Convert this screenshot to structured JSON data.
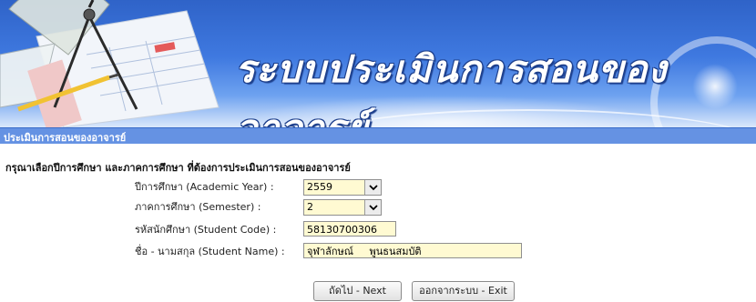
{
  "banner": {
    "title": "ระบบประเมินการสอนของอาจารย์"
  },
  "section": {
    "title": "ประเมินการสอนของอาจารย์"
  },
  "form": {
    "instruction": "กรุณาเลือกปีการศึกษา และภาคการศึกษา ที่ต้องการประเมินการสอนของอาจารย์",
    "academic_year": {
      "label": "ปีการศึกษา (Academic Year) :",
      "value": "2559"
    },
    "semester": {
      "label": "ภาคการศึกษา (Semester) :",
      "value": "2"
    },
    "student_code": {
      "label": "รหัสนักศึกษา (Student Code) :",
      "value": "58130700306"
    },
    "student_name": {
      "label": "ชื่อ - นามสกุล (Student Name) :",
      "value": "จุฬาลักษณ์     พูนธนสมบัติ"
    }
  },
  "buttons": {
    "next": "ถัดไป  - Next",
    "exit": "ออกจากระบบ  - Exit"
  },
  "colors": {
    "section_bar": "#6592e3",
    "field_bg": "#fffad2",
    "banner_blue": "#3f79e0"
  }
}
